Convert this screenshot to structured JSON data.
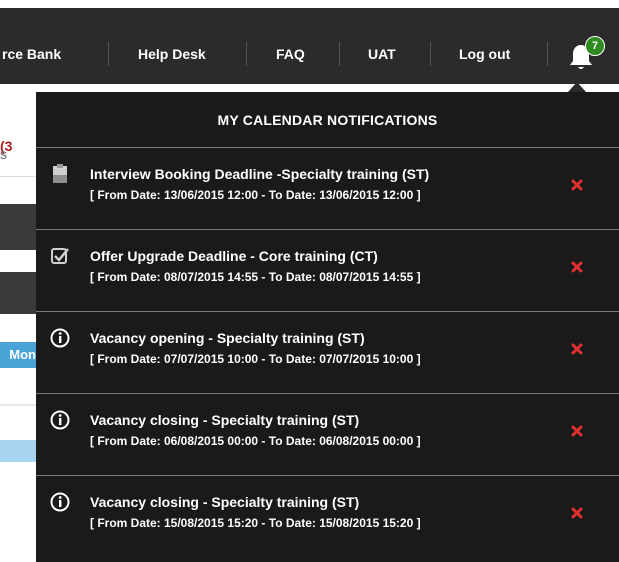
{
  "nav": {
    "items": [
      {
        "label": "rce Bank"
      },
      {
        "label": "Help Desk"
      },
      {
        "label": "FAQ"
      },
      {
        "label": "UAT"
      },
      {
        "label": "Log out"
      }
    ],
    "notification_count": "7"
  },
  "background": {
    "tab_fragment": "s",
    "tab_count_fragment": "(3",
    "button_fragment": "Mon"
  },
  "panel": {
    "title": "MY CALENDAR NOTIFICATIONS",
    "notifications": [
      {
        "icon": "clipboard-icon",
        "title": "Interview Booking Deadline -Specialty training (ST)",
        "dates": "[ From Date: 13/06/2015 12:00 - To Date: 13/06/2015 12:00 ]"
      },
      {
        "icon": "checkbox-icon",
        "title": "Offer Upgrade Deadline - Core training (CT)",
        "dates": "[ From Date: 08/07/2015 14:55 - To Date: 08/07/2015 14:55 ]"
      },
      {
        "icon": "info-icon",
        "title": "Vacancy opening - Specialty training (ST)",
        "dates": "[ From Date: 07/07/2015 10:00 - To Date: 07/07/2015 10:00 ]"
      },
      {
        "icon": "info-icon",
        "title": "Vacancy closing - Specialty training (ST)",
        "dates": "[ From Date: 06/08/2015 00:00 - To Date: 06/08/2015 00:00 ]"
      },
      {
        "icon": "info-icon",
        "title": "Vacancy closing - Specialty training (ST)",
        "dates": "[ From Date: 15/08/2015 15:20 - To Date: 15/08/2015 15:20 ]"
      }
    ]
  },
  "colors": {
    "topbar": "#2b2b2b",
    "panel": "#1a1a1a",
    "badge": "#2e8b1f",
    "close": "#e03030"
  }
}
